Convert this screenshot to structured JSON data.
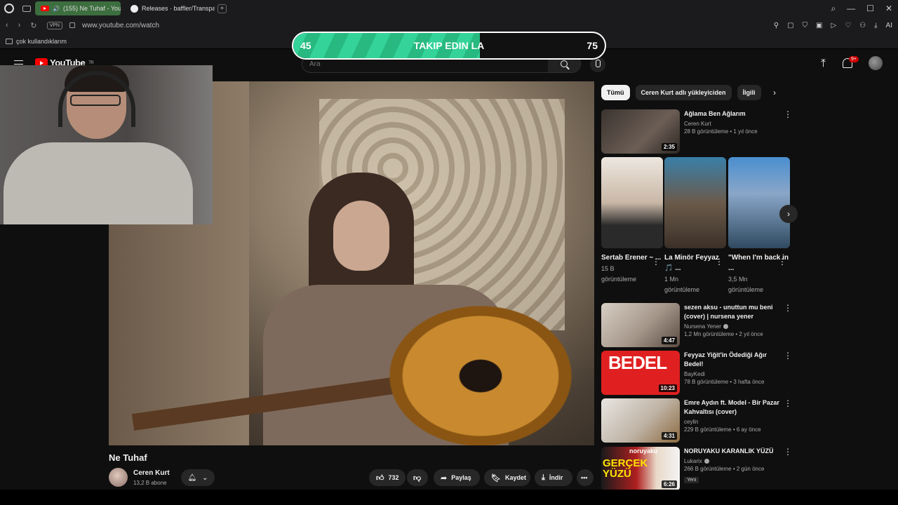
{
  "browser": {
    "tabs": [
      {
        "label": "(155) Ne Tuhaf - YouTu",
        "active": true
      },
      {
        "label": "Releases · baffler/Transpa",
        "active": false
      }
    ],
    "url": "www.youtube.com/watch",
    "vpn_label": "VPN",
    "bookmark_folder": "çok kullandıklarım",
    "ai_label": "AI"
  },
  "youtube": {
    "logo_text": "YouTube",
    "region": "TR",
    "search_placeholder": "Ara",
    "notification_badge": "9+"
  },
  "overlay": {
    "current": "45",
    "goal": "75",
    "label": "TAKIP EDIN LA",
    "progress_fraction": 0.6
  },
  "video": {
    "title": "Ne Tuhaf",
    "channel": "Ceren Kurt",
    "subscribers": "13,2 B abone",
    "likes": "732",
    "share_label": "Paylaş",
    "save_label": "Kaydet",
    "download_label": "İndir"
  },
  "sidebar": {
    "chips": [
      "Tümü",
      "Ceren Kurt adlı yükleyiciden",
      "İlgili"
    ],
    "videos": [
      {
        "title": "Ağlama Ben Ağlarım",
        "channel": "Ceren Kurt",
        "stats": "28 B görüntüleme • 1 yıl önce",
        "duration": "2:35"
      },
      {
        "title": "sezen aksu - unuttun mu beni (cover) | nursena yener",
        "channel": "Nursena Yener",
        "stats": "1,2 Mn görüntüleme • 2 yıl önce",
        "duration": "4:47"
      },
      {
        "title": "Feyyaz Yiğit'in Ödediği Ağır Bedel!",
        "channel": "BayKedi",
        "stats": "78 B görüntüleme • 3 hafta önce",
        "duration": "10:23",
        "thumb_text": "BEDEL"
      },
      {
        "title": "Emre Aydın ft. Model - Bir Pazar Kahvaltısı (cover)",
        "channel": "ceylin",
        "stats": "229 B görüntüleme • 6 ay önce",
        "duration": "4:31"
      },
      {
        "title": "NORUYAKU KARANLIK YÜZÜ",
        "channel": "Lukarix",
        "stats": "266 B görüntüleme • 2 gün önce",
        "duration": "6:26",
        "badge": "Yeni",
        "thumb_text": "GERÇEK YÜZÜ",
        "thumb_top": "noruyaku"
      }
    ],
    "shorts": [
      {
        "title": "Sertab Erener ~ ...",
        "views": "15 B",
        "views_label": "görüntüleme"
      },
      {
        "title": "La Minör Feyyaz 🎵 ...",
        "views": "1 Mn",
        "views_label": "görüntüleme"
      },
      {
        "title": "\"When I'm back in ...",
        "views": "3,5 Mn",
        "views_label": "görüntüleme"
      }
    ]
  }
}
